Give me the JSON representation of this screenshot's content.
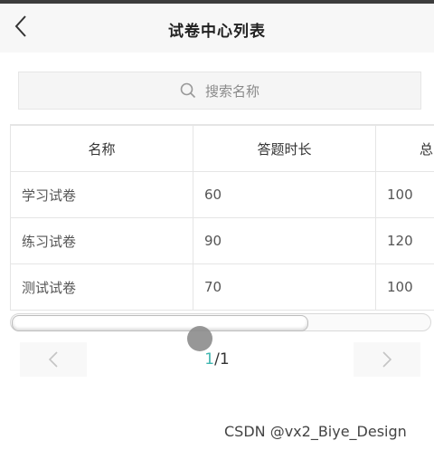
{
  "header": {
    "title": "试卷中心列表"
  },
  "search": {
    "placeholder": "搜索名称"
  },
  "table": {
    "columns": [
      "名称",
      "答题时长",
      "总"
    ],
    "rows": [
      [
        "学习试卷",
        "60",
        "100"
      ],
      [
        "练习试卷",
        "90",
        "120"
      ],
      [
        "测试试卷",
        "70",
        "100"
      ]
    ]
  },
  "pagination": {
    "current": "1",
    "separator": "/",
    "total": "1"
  },
  "watermark": "CSDN @vx2_Biye_Design",
  "colors": {
    "accent": "#3fb6b0",
    "nav_bg": "#f7f7f7"
  }
}
